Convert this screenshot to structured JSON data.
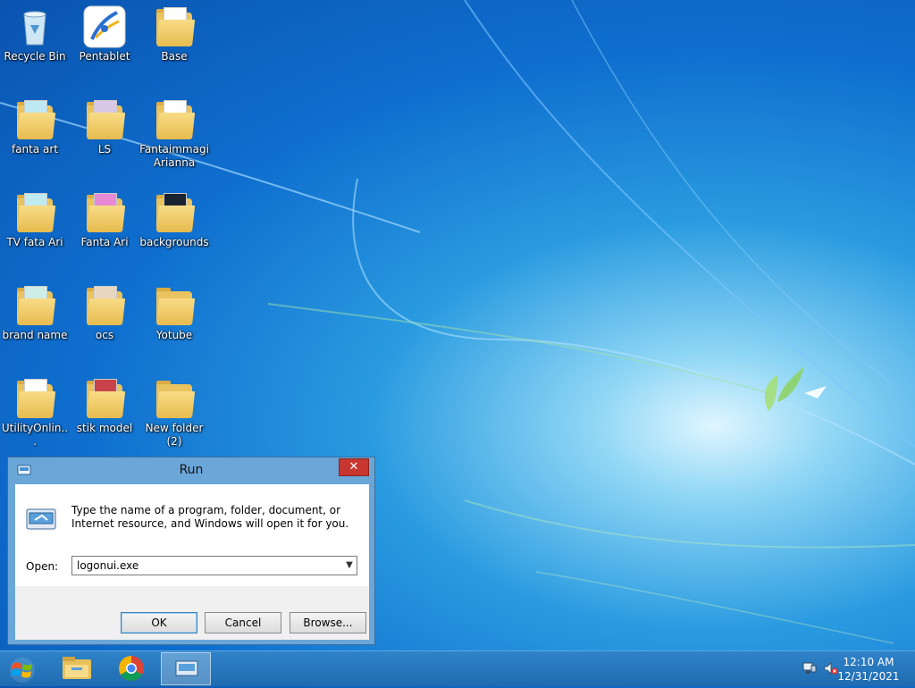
{
  "desktop": {
    "icons": [
      {
        "label": "Recycle Bin"
      },
      {
        "label": "Pentablet"
      },
      {
        "label": "Base"
      },
      {
        "label": "fanta art"
      },
      {
        "label": "LS"
      },
      {
        "label": "Fantaimmagi Arianna"
      },
      {
        "label": "TV  fata Ari"
      },
      {
        "label": "Fanta Ari"
      },
      {
        "label": "backgrounds"
      },
      {
        "label": "brand name"
      },
      {
        "label": "ocs"
      },
      {
        "label": "Yotube"
      },
      {
        "label": "UtilityOnlin..."
      },
      {
        "label": "stik  model"
      },
      {
        "label": "New folder (2)"
      }
    ]
  },
  "run_dialog": {
    "title": "Run",
    "close_label": "✕",
    "description": "Type the name of a program, folder, document, or Internet resource, and Windows will open it for you.",
    "open_label": "Open:",
    "open_value": "logonui.exe",
    "ok_label": "OK",
    "cancel_label": "Cancel",
    "browse_label": "Browse..."
  },
  "taskbar": {
    "pinned": [
      {
        "icon": "file-explorer-icon"
      },
      {
        "icon": "chrome-icon"
      },
      {
        "icon": "run-icon"
      }
    ],
    "clock_time": "12:10 AM",
    "clock_date": "12/31/2021"
  },
  "colors": {
    "close_button": "#c7372f",
    "taskbar": "#1f6bb0",
    "dialog_frame": "#6aa7d8"
  }
}
